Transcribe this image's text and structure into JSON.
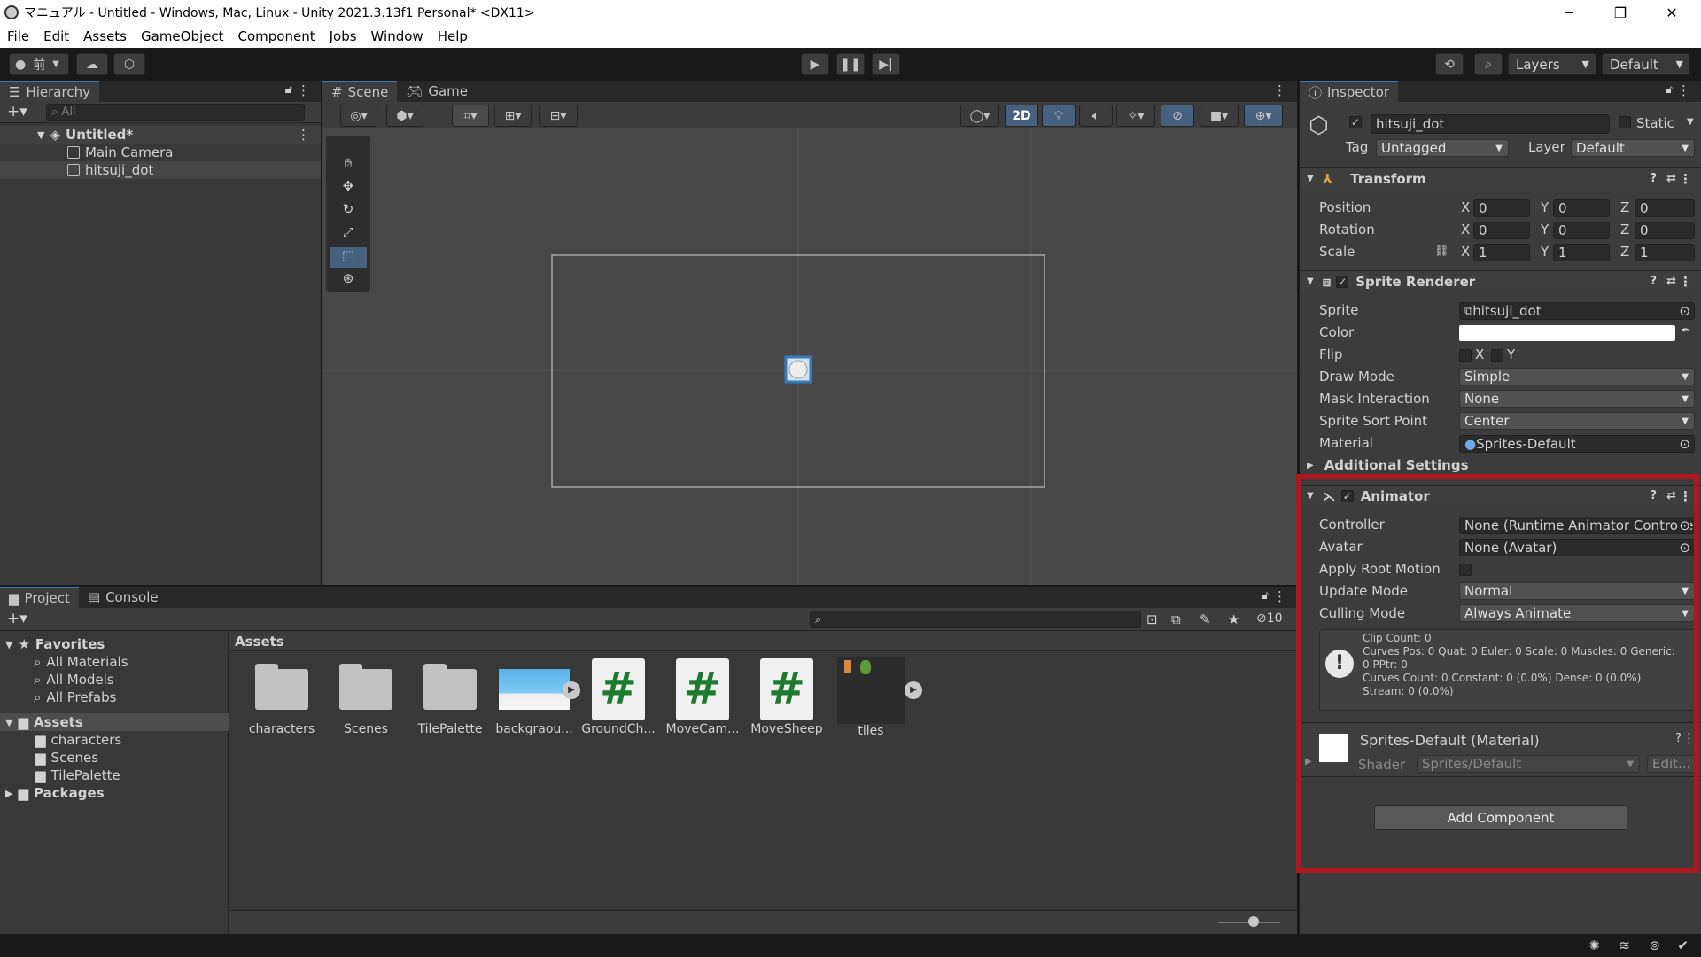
{
  "window": {
    "title": "マニュアル - Untitled - Windows, Mac, Linux - Unity 2021.3.13f1 Personal* <DX11>"
  },
  "menu": [
    "File",
    "Edit",
    "Assets",
    "GameObject",
    "Component",
    "Jobs",
    "Window",
    "Help"
  ],
  "toolbar": {
    "layers": "Layers",
    "layout": "Default",
    "account_initial": "前"
  },
  "hierarchy": {
    "tab": "Hierarchy",
    "search_placeholder": "All",
    "scene": "Untitled*",
    "items": [
      "Main Camera",
      "hitsuji_dot"
    ]
  },
  "scene_view": {
    "tabs": [
      "Scene",
      "Game"
    ],
    "mode_2d": "2D"
  },
  "inspector": {
    "tab": "Inspector",
    "object_name": "hitsuji_dot",
    "static_label": "Static",
    "tag_label": "Tag",
    "tag_value": "Untagged",
    "layer_label": "Layer",
    "layer_value": "Default",
    "transform": {
      "title": "Transform",
      "rows": [
        {
          "label": "Position",
          "x": "0",
          "y": "0",
          "z": "0"
        },
        {
          "label": "Rotation",
          "x": "0",
          "y": "0",
          "z": "0"
        },
        {
          "label": "Scale",
          "x": "1",
          "y": "1",
          "z": "1"
        }
      ]
    },
    "sprite_renderer": {
      "title": "Sprite Renderer",
      "sprite_label": "Sprite",
      "sprite_value": "hitsuji_dot",
      "color_label": "Color",
      "flip_label": "Flip",
      "flip_x": "X",
      "flip_y": "Y",
      "draw_mode_label": "Draw Mode",
      "draw_mode": "Simple",
      "mask_label": "Mask Interaction",
      "mask": "None",
      "sort_label": "Sprite Sort Point",
      "sort": "Center",
      "material_label": "Material",
      "material": "Sprites-Default",
      "additional": "Additional Settings"
    },
    "animator": {
      "title": "Animator",
      "controller_label": "Controller",
      "controller": "None (Runtime Animator Controlle",
      "avatar_label": "Avatar",
      "avatar": "None (Avatar)",
      "root_motion_label": "Apply Root Motion",
      "update_label": "Update Mode",
      "update": "Normal",
      "culling_label": "Culling Mode",
      "culling": "Always Animate",
      "info": [
        "Clip Count: 0",
        "Curves Pos: 0 Quat: 0 Euler: 0 Scale: 0 Muscles: 0 Generic:",
        "0 PPtr: 0",
        "Curves Count: 0 Constant: 0 (0.0%) Dense: 0 (0.0%)",
        "Stream: 0 (0.0%)"
      ]
    },
    "material": {
      "title": "Sprites-Default (Material)",
      "shader_label": "Shader",
      "shader": "Sprites/Default",
      "edit": "Edit..."
    },
    "add_component": "Add Component"
  },
  "project": {
    "tabs": [
      "Project",
      "Console"
    ],
    "favorites": "Favorites",
    "favorite_items": [
      "All Materials",
      "All Models",
      "All Prefabs"
    ],
    "assets_root": "Assets",
    "folders": [
      "characters",
      "Scenes",
      "TilePalette"
    ],
    "packages": "Packages",
    "breadcrumb": "Assets",
    "hidden_count": "10",
    "assets": [
      "characters",
      "Scenes",
      "TilePalette",
      "backgraou...",
      "GroundCh...",
      "MoveCam...",
      "MoveSheep",
      "tiles"
    ]
  },
  "colors": {
    "highlight_box": "#b0171c",
    "accent": "#3a79bb"
  }
}
